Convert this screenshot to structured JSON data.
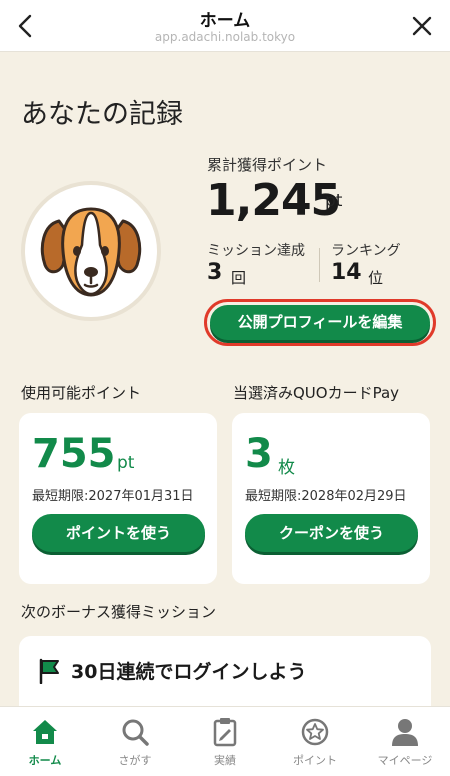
{
  "header": {
    "title": "ホーム",
    "url": "app.adachi.nolab.tokyo"
  },
  "page_title": "あなたの記録",
  "stats": {
    "total_label": "累計獲得ポイント",
    "total_value": "1,245",
    "total_unit": "pt",
    "mission_label": "ミッション達成",
    "mission_value": "3",
    "mission_unit": "回",
    "rank_label": "ランキング",
    "rank_value": "14",
    "rank_unit": "位"
  },
  "profile_button": "公開プロフィールを編集",
  "usable": {
    "label": "使用可能ポイント",
    "value": "755",
    "unit": "pt",
    "expire": "最短期限:2027年01月31日",
    "button": "ポイントを使う"
  },
  "quo": {
    "label": "当選済みQUOカードPay",
    "value": "3",
    "unit": "枚",
    "expire": "最短期限:2028年02月29日",
    "button": "クーポンを使う"
  },
  "bonus": {
    "label": "次のボーナス獲得ミッション",
    "mission": "30日連続でログインしよう"
  },
  "tabs": [
    {
      "label": "ホーム",
      "icon": "home-icon",
      "active": true
    },
    {
      "label": "さがす",
      "icon": "search-icon",
      "active": false
    },
    {
      "label": "実績",
      "icon": "clipboard-icon",
      "active": false
    },
    {
      "label": "ポイント",
      "icon": "star-coin-icon",
      "active": false
    },
    {
      "label": "マイページ",
      "icon": "person-icon",
      "active": false
    }
  ],
  "colors": {
    "accent": "#128a4a",
    "background": "#f5f0e4",
    "highlight_border": "#e03a2a"
  }
}
